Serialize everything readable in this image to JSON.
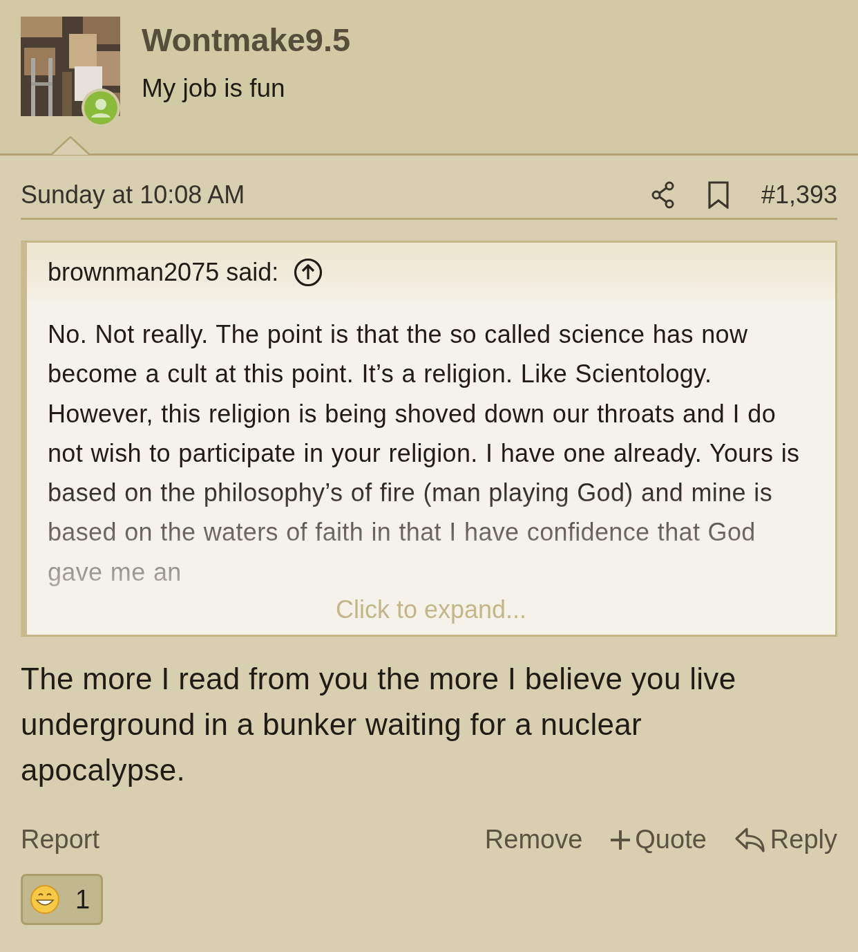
{
  "user": {
    "name": "Wontmake9.5",
    "title": "My job is fun",
    "online": true
  },
  "post": {
    "time": "Sunday at 10:08 AM",
    "number": "#1,393",
    "quote": {
      "author": "brownman2075 said:",
      "text": "No. Not really. The point is that the so called science has now become a cult at this point. It’s a religion. Like Scientology. However, this religion is being shoved down our throats and I do not wish to participate in your religion. I have one already. Yours is based on the philosophy’s of fire (man playing God) and mine is based on the waters of faith in that I have confidence that God gave me an",
      "expand": "Click to expand..."
    },
    "body": "The more I read from you the more I believe you live underground in a bunker waiting for a nuclear apocalypse.",
    "actions": {
      "left": [
        "Report"
      ],
      "right": [
        {
          "kind": "plain",
          "label": "Remove"
        },
        {
          "kind": "plus",
          "label": "Quote"
        },
        {
          "kind": "reply",
          "label": "Reply"
        }
      ]
    },
    "reactions": [
      {
        "kind": "grin",
        "count": "1"
      }
    ]
  }
}
